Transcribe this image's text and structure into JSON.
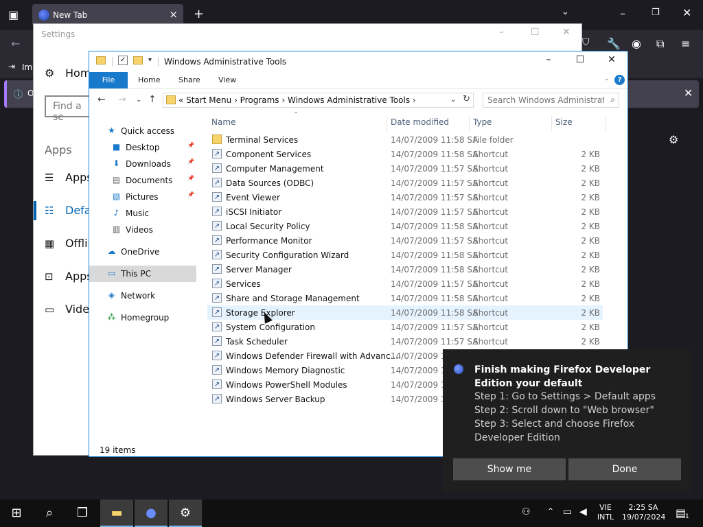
{
  "firefox": {
    "tab_title": "New Tab",
    "bookmarks_import": "Im",
    "infobar_text": "O"
  },
  "settings": {
    "title": "Settings",
    "home": "Home",
    "find_placeholder": "Find a se",
    "section": "Apps",
    "nav": [
      {
        "label": "Apps",
        "icon": "apps-list-icon"
      },
      {
        "label": "Defau",
        "icon": "default-apps-icon"
      },
      {
        "label": "Offlin",
        "icon": "offline-maps-icon"
      },
      {
        "label": "Apps",
        "icon": "apps-websites-icon"
      },
      {
        "label": "Video",
        "icon": "video-playback-icon"
      }
    ]
  },
  "explorer": {
    "title": "Windows Administrative Tools",
    "ribbon_tabs": [
      "File",
      "Home",
      "Share",
      "View"
    ],
    "breadcrumbs": "«  Start Menu  ›  Programs  ›  Windows Administrative Tools  ›",
    "search_placeholder": "Search Windows Administrati...",
    "nav_items": [
      {
        "label": "Quick access",
        "icon": "quick-access-star-icon",
        "indent": false,
        "pinned": false
      },
      {
        "label": "Desktop",
        "icon": "desktop-icon",
        "indent": true,
        "pinned": true
      },
      {
        "label": "Downloads",
        "icon": "downloads-icon",
        "indent": true,
        "pinned": true
      },
      {
        "label": "Documents",
        "icon": "documents-icon",
        "indent": true,
        "pinned": true
      },
      {
        "label": "Pictures",
        "icon": "pictures-icon",
        "indent": true,
        "pinned": true
      },
      {
        "label": "Music",
        "icon": "music-icon",
        "indent": true,
        "pinned": false
      },
      {
        "label": "Videos",
        "icon": "videos-icon",
        "indent": true,
        "pinned": false
      },
      {
        "label": "OneDrive",
        "icon": "onedrive-icon",
        "indent": false,
        "pinned": false
      },
      {
        "label": "This PC",
        "icon": "this-pc-icon",
        "indent": false,
        "pinned": false
      },
      {
        "label": "Network",
        "icon": "network-icon",
        "indent": false,
        "pinned": false
      },
      {
        "label": "Homegroup",
        "icon": "homegroup-icon",
        "indent": false,
        "pinned": false
      }
    ],
    "columns": {
      "name": "Name",
      "date": "Date modified",
      "type": "Type",
      "size": "Size"
    },
    "files": [
      {
        "name": "Terminal Services",
        "date": "14/07/2009 11:58 SA",
        "type": "File folder",
        "size": ""
      },
      {
        "name": "Component Services",
        "date": "14/07/2009 11:58 SA",
        "type": "Shortcut",
        "size": "2 KB"
      },
      {
        "name": "Computer Management",
        "date": "14/07/2009 11:57 SA",
        "type": "Shortcut",
        "size": "2 KB"
      },
      {
        "name": "Data Sources (ODBC)",
        "date": "14/07/2009 11:57 SA",
        "type": "Shortcut",
        "size": "2 KB"
      },
      {
        "name": "Event Viewer",
        "date": "14/07/2009 11:57 SA",
        "type": "Shortcut",
        "size": "2 KB"
      },
      {
        "name": "iSCSI Initiator",
        "date": "14/07/2009 11:57 SA",
        "type": "Shortcut",
        "size": "2 KB"
      },
      {
        "name": "Local Security Policy",
        "date": "14/07/2009 11:58 SA",
        "type": "Shortcut",
        "size": "2 KB"
      },
      {
        "name": "Performance Monitor",
        "date": "14/07/2009 11:57 SA",
        "type": "Shortcut",
        "size": "2 KB"
      },
      {
        "name": "Security Configuration Wizard",
        "date": "14/07/2009 11:58 SA",
        "type": "Shortcut",
        "size": "2 KB"
      },
      {
        "name": "Server Manager",
        "date": "14/07/2009 11:58 SA",
        "type": "Shortcut",
        "size": "2 KB"
      },
      {
        "name": "Services",
        "date": "14/07/2009 11:57 SA",
        "type": "Shortcut",
        "size": "2 KB"
      },
      {
        "name": "Share and Storage Management",
        "date": "14/07/2009 11:58 SA",
        "type": "Shortcut",
        "size": "2 KB"
      },
      {
        "name": "Storage Explorer",
        "date": "14/07/2009 11:58 SA",
        "type": "Shortcut",
        "size": "2 KB"
      },
      {
        "name": "System Configuration",
        "date": "14/07/2009 11:57 SA",
        "type": "Shortcut",
        "size": "2 KB"
      },
      {
        "name": "Task Scheduler",
        "date": "14/07/2009 11:57 SA",
        "type": "Shortcut",
        "size": "2 KB"
      },
      {
        "name": "Windows Defender Firewall with Advanc...",
        "date": "14/07/2009 11:",
        "type": "",
        "size": ""
      },
      {
        "name": "Windows Memory Diagnostic",
        "date": "14/07/2009 11:",
        "type": "",
        "size": ""
      },
      {
        "name": "Windows PowerShell Modules",
        "date": "14/07/2009 12:",
        "type": "",
        "size": ""
      },
      {
        "name": "Windows Server Backup",
        "date": "14/07/2009 11:",
        "type": "",
        "size": ""
      }
    ],
    "status": "19 items"
  },
  "toast": {
    "title": "Finish making Firefox Developer Edition your default",
    "steps": [
      "Step 1: Go to Settings > Default apps",
      "Step 2: Scroll down to \"Web browser\"",
      "Step 3: Select and choose Firefox Developer Edition"
    ],
    "show_me": "Show me",
    "done": "Done"
  },
  "taskbar": {
    "lang_top": "VIE",
    "lang_bottom": "INTL",
    "time": "2:25 SA",
    "date": "19/07/2024",
    "notif_count": "1"
  },
  "colors": {
    "accent": "#1979ca",
    "hover_row": "#e5f3ff",
    "firefox_dark": "#1c1b22"
  }
}
